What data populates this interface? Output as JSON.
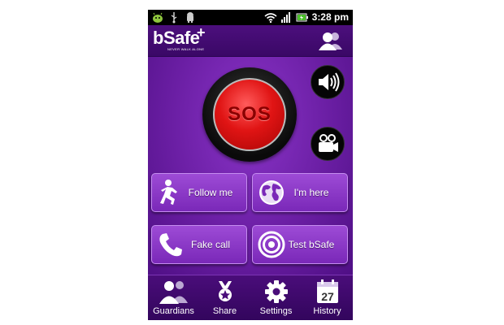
{
  "status_bar": {
    "icons": [
      "android-debug-icon",
      "usb-icon",
      "android-icon",
      "wifi-icon",
      "signal-icon",
      "battery-icon"
    ],
    "time": "3:28 pm"
  },
  "header": {
    "logo_text": "bSafe",
    "logo_plus": "+",
    "logo_tagline": "NEVER WALK ALONE",
    "profile_icon": "profile-icon"
  },
  "main": {
    "sos_label": "SOS",
    "sound_icon": "speaker-icon",
    "video_icon": "video-camera-icon",
    "actions": [
      {
        "label": "Follow me",
        "icon": "running-person-icon"
      },
      {
        "label": "I'm here",
        "icon": "globe-icon"
      },
      {
        "label": "Fake call",
        "icon": "phone-icon"
      },
      {
        "label": "Test bSafe",
        "icon": "target-icon"
      }
    ]
  },
  "nav": {
    "items": [
      {
        "label": "Guardians",
        "icon": "guardians-icon"
      },
      {
        "label": "Share",
        "icon": "share-icon"
      },
      {
        "label": "Settings",
        "icon": "gear-icon"
      },
      {
        "label": "History",
        "icon": "calendar-icon",
        "calendar_day": "27"
      }
    ]
  },
  "colors": {
    "background": "#6a1ea3",
    "header": "#4c0f7d",
    "sos_red": "#e01414",
    "button": "#8a38c8"
  }
}
